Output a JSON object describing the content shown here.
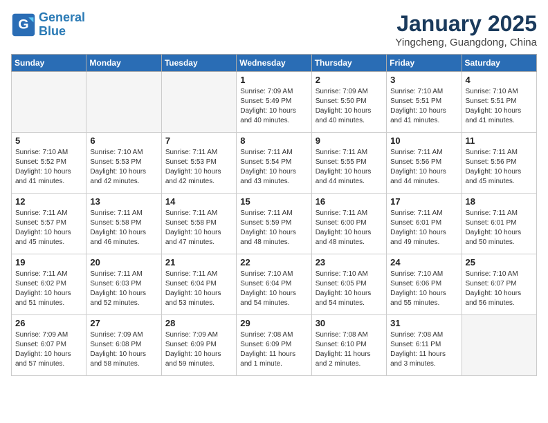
{
  "header": {
    "logo_line1": "General",
    "logo_line2": "Blue",
    "month": "January 2025",
    "location": "Yingcheng, Guangdong, China"
  },
  "weekdays": [
    "Sunday",
    "Monday",
    "Tuesday",
    "Wednesday",
    "Thursday",
    "Friday",
    "Saturday"
  ],
  "weeks": [
    [
      {
        "day": "",
        "sunrise": "",
        "sunset": "",
        "daylight": ""
      },
      {
        "day": "",
        "sunrise": "",
        "sunset": "",
        "daylight": ""
      },
      {
        "day": "",
        "sunrise": "",
        "sunset": "",
        "daylight": ""
      },
      {
        "day": "1",
        "sunrise": "Sunrise: 7:09 AM",
        "sunset": "Sunset: 5:49 PM",
        "daylight": "Daylight: 10 hours and 40 minutes."
      },
      {
        "day": "2",
        "sunrise": "Sunrise: 7:09 AM",
        "sunset": "Sunset: 5:50 PM",
        "daylight": "Daylight: 10 hours and 40 minutes."
      },
      {
        "day": "3",
        "sunrise": "Sunrise: 7:10 AM",
        "sunset": "Sunset: 5:51 PM",
        "daylight": "Daylight: 10 hours and 41 minutes."
      },
      {
        "day": "4",
        "sunrise": "Sunrise: 7:10 AM",
        "sunset": "Sunset: 5:51 PM",
        "daylight": "Daylight: 10 hours and 41 minutes."
      }
    ],
    [
      {
        "day": "5",
        "sunrise": "Sunrise: 7:10 AM",
        "sunset": "Sunset: 5:52 PM",
        "daylight": "Daylight: 10 hours and 41 minutes."
      },
      {
        "day": "6",
        "sunrise": "Sunrise: 7:10 AM",
        "sunset": "Sunset: 5:53 PM",
        "daylight": "Daylight: 10 hours and 42 minutes."
      },
      {
        "day": "7",
        "sunrise": "Sunrise: 7:11 AM",
        "sunset": "Sunset: 5:53 PM",
        "daylight": "Daylight: 10 hours and 42 minutes."
      },
      {
        "day": "8",
        "sunrise": "Sunrise: 7:11 AM",
        "sunset": "Sunset: 5:54 PM",
        "daylight": "Daylight: 10 hours and 43 minutes."
      },
      {
        "day": "9",
        "sunrise": "Sunrise: 7:11 AM",
        "sunset": "Sunset: 5:55 PM",
        "daylight": "Daylight: 10 hours and 44 minutes."
      },
      {
        "day": "10",
        "sunrise": "Sunrise: 7:11 AM",
        "sunset": "Sunset: 5:56 PM",
        "daylight": "Daylight: 10 hours and 44 minutes."
      },
      {
        "day": "11",
        "sunrise": "Sunrise: 7:11 AM",
        "sunset": "Sunset: 5:56 PM",
        "daylight": "Daylight: 10 hours and 45 minutes."
      }
    ],
    [
      {
        "day": "12",
        "sunrise": "Sunrise: 7:11 AM",
        "sunset": "Sunset: 5:57 PM",
        "daylight": "Daylight: 10 hours and 45 minutes."
      },
      {
        "day": "13",
        "sunrise": "Sunrise: 7:11 AM",
        "sunset": "Sunset: 5:58 PM",
        "daylight": "Daylight: 10 hours and 46 minutes."
      },
      {
        "day": "14",
        "sunrise": "Sunrise: 7:11 AM",
        "sunset": "Sunset: 5:58 PM",
        "daylight": "Daylight: 10 hours and 47 minutes."
      },
      {
        "day": "15",
        "sunrise": "Sunrise: 7:11 AM",
        "sunset": "Sunset: 5:59 PM",
        "daylight": "Daylight: 10 hours and 48 minutes."
      },
      {
        "day": "16",
        "sunrise": "Sunrise: 7:11 AM",
        "sunset": "Sunset: 6:00 PM",
        "daylight": "Daylight: 10 hours and 48 minutes."
      },
      {
        "day": "17",
        "sunrise": "Sunrise: 7:11 AM",
        "sunset": "Sunset: 6:01 PM",
        "daylight": "Daylight: 10 hours and 49 minutes."
      },
      {
        "day": "18",
        "sunrise": "Sunrise: 7:11 AM",
        "sunset": "Sunset: 6:01 PM",
        "daylight": "Daylight: 10 hours and 50 minutes."
      }
    ],
    [
      {
        "day": "19",
        "sunrise": "Sunrise: 7:11 AM",
        "sunset": "Sunset: 6:02 PM",
        "daylight": "Daylight: 10 hours and 51 minutes."
      },
      {
        "day": "20",
        "sunrise": "Sunrise: 7:11 AM",
        "sunset": "Sunset: 6:03 PM",
        "daylight": "Daylight: 10 hours and 52 minutes."
      },
      {
        "day": "21",
        "sunrise": "Sunrise: 7:11 AM",
        "sunset": "Sunset: 6:04 PM",
        "daylight": "Daylight: 10 hours and 53 minutes."
      },
      {
        "day": "22",
        "sunrise": "Sunrise: 7:10 AM",
        "sunset": "Sunset: 6:04 PM",
        "daylight": "Daylight: 10 hours and 54 minutes."
      },
      {
        "day": "23",
        "sunrise": "Sunrise: 7:10 AM",
        "sunset": "Sunset: 6:05 PM",
        "daylight": "Daylight: 10 hours and 54 minutes."
      },
      {
        "day": "24",
        "sunrise": "Sunrise: 7:10 AM",
        "sunset": "Sunset: 6:06 PM",
        "daylight": "Daylight: 10 hours and 55 minutes."
      },
      {
        "day": "25",
        "sunrise": "Sunrise: 7:10 AM",
        "sunset": "Sunset: 6:07 PM",
        "daylight": "Daylight: 10 hours and 56 minutes."
      }
    ],
    [
      {
        "day": "26",
        "sunrise": "Sunrise: 7:09 AM",
        "sunset": "Sunset: 6:07 PM",
        "daylight": "Daylight: 10 hours and 57 minutes."
      },
      {
        "day": "27",
        "sunrise": "Sunrise: 7:09 AM",
        "sunset": "Sunset: 6:08 PM",
        "daylight": "Daylight: 10 hours and 58 minutes."
      },
      {
        "day": "28",
        "sunrise": "Sunrise: 7:09 AM",
        "sunset": "Sunset: 6:09 PM",
        "daylight": "Daylight: 10 hours and 59 minutes."
      },
      {
        "day": "29",
        "sunrise": "Sunrise: 7:08 AM",
        "sunset": "Sunset: 6:09 PM",
        "daylight": "Daylight: 11 hours and 1 minute."
      },
      {
        "day": "30",
        "sunrise": "Sunrise: 7:08 AM",
        "sunset": "Sunset: 6:10 PM",
        "daylight": "Daylight: 11 hours and 2 minutes."
      },
      {
        "day": "31",
        "sunrise": "Sunrise: 7:08 AM",
        "sunset": "Sunset: 6:11 PM",
        "daylight": "Daylight: 11 hours and 3 minutes."
      },
      {
        "day": "",
        "sunrise": "",
        "sunset": "",
        "daylight": ""
      }
    ]
  ]
}
